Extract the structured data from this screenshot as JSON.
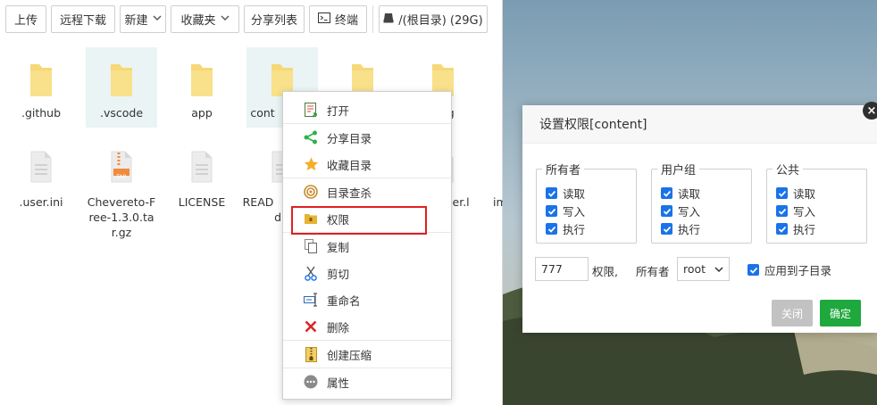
{
  "toolbar": {
    "upload": "上传",
    "remote_download": "远程下载",
    "new": "新建",
    "favorites": "收藏夹",
    "share_list": "分享列表",
    "terminal": "终端",
    "disk": "/(根目录) (29G)"
  },
  "files": [
    {
      "name": ".github",
      "type": "folder"
    },
    {
      "name": ".vscode",
      "type": "folder"
    },
    {
      "name": "app",
      "type": "folder"
    },
    {
      "name": "cont",
      "type": "folder"
    },
    {
      "name": "",
      "type": "folder"
    },
    {
      "name": "ing",
      "type": "folder"
    },
    {
      "name": ".user.ini",
      "type": "file"
    },
    {
      "name": "Chevereto-Free-1.3.0.tar.gz",
      "type": "archive"
    },
    {
      "name": "LICENSE",
      "type": "file"
    },
    {
      "name": "READ",
      "type": "file"
    },
    {
      "name": "d",
      "type": "file"
    },
    {
      "name": "ser.l",
      "type": "file"
    },
    {
      "name": "im",
      "type": "file"
    }
  ],
  "tar_badge": "TAR",
  "context_menu": {
    "items": [
      {
        "label": "打开",
        "icon": "open-icon"
      },
      {
        "label": "分享目录",
        "icon": "share-icon"
      },
      {
        "label": "收藏目录",
        "icon": "star-icon"
      },
      {
        "label": "目录查杀",
        "icon": "scan-icon"
      },
      {
        "label": "权限",
        "icon": "permission-icon"
      },
      {
        "label": "复制",
        "icon": "copy-icon"
      },
      {
        "label": "剪切",
        "icon": "cut-icon"
      },
      {
        "label": "重命名",
        "icon": "rename-icon"
      },
      {
        "label": "删除",
        "icon": "delete-icon"
      },
      {
        "label": "创建压缩",
        "icon": "compress-icon"
      },
      {
        "label": "属性",
        "icon": "properties-icon"
      }
    ]
  },
  "dialog": {
    "title": "设置权限[content]",
    "close": "×",
    "groups": [
      {
        "title": "所有者",
        "read": "读取",
        "write": "写入",
        "exec": "执行"
      },
      {
        "title": "用户组",
        "read": "读取",
        "write": "写入",
        "exec": "执行"
      },
      {
        "title": "公共",
        "read": "读取",
        "write": "写入",
        "exec": "执行"
      }
    ],
    "mode_value": "777",
    "perm_label": "权限,",
    "owner_label": "所有者",
    "owner_value": "root",
    "apply_sub": "应用到子目录",
    "cancel": "关闭",
    "confirm": "确定"
  },
  "colors": {
    "accent_blue": "#1a73e8",
    "confirm_green": "#1fa83d",
    "cancel_gray": "#c2c2c2",
    "highlight_red": "#e02020",
    "folder_yellow": "#f6d878"
  }
}
